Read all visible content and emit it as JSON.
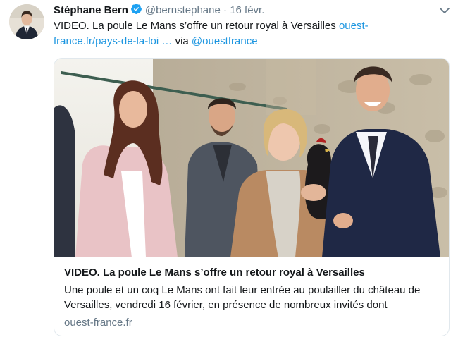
{
  "tweet": {
    "author_name": "Stéphane Bern",
    "handle": "@bernstephane",
    "separator": "·",
    "date": "16 févr.",
    "text_part1": "VIDEO. La poule Le Mans s’offre un retour royal à Versailles ",
    "link_line1": "ouest-",
    "link_line2": "france.fr/pays-de-la-loi …",
    "via_word": " via ",
    "mention": "@ouestfrance"
  },
  "card": {
    "title": "VIDEO. La poule Le Mans s’offre un retour royal à Versailles",
    "description": "Une poule et un coq Le Mans ont fait leur entrée au poulailler du château de Versailles, vendredi 16 février, en présence de nombreux invités dont",
    "domain": "ouest-france.fr"
  },
  "colors": {
    "link": "#1b95e0",
    "secondary_text": "#657786",
    "primary_text": "#14171a",
    "border": "#e1e8ed",
    "verified": "#1da1f2"
  },
  "icons": {
    "verified": "verified-badge-icon",
    "caret": "chevron-down-icon"
  }
}
